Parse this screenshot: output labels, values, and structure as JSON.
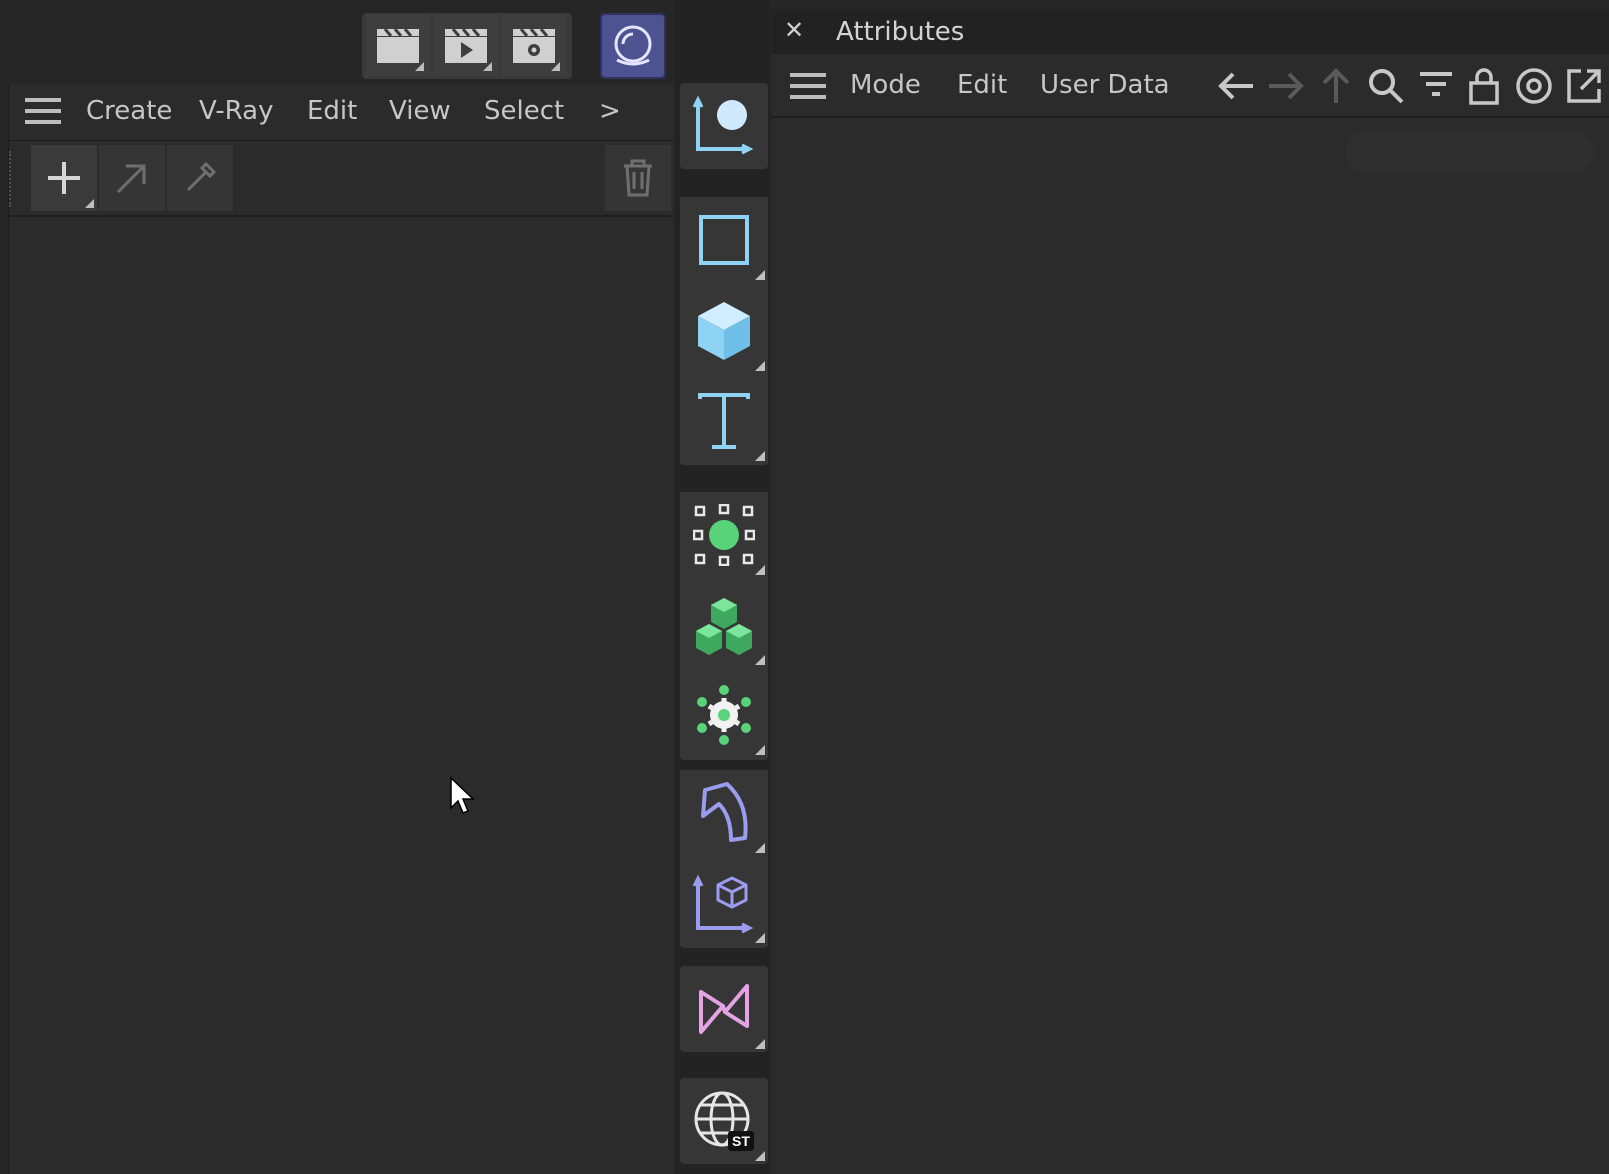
{
  "left_panel": {
    "menu": [
      "Create",
      "V-Ray",
      "Edit",
      "View",
      "Select"
    ],
    "more": ">"
  },
  "attributes": {
    "close": "✕",
    "title": "Attributes",
    "menu": [
      "Mode",
      "Edit",
      "User Data"
    ]
  },
  "palette": {
    "globe_badge": "ST"
  },
  "colors": {
    "accent_blue": "#8fd3f4",
    "accent_green": "#59d37a",
    "accent_purple": "#9a9cf0",
    "accent_pink": "#e5a3e4",
    "redshift": "#4d5291"
  }
}
